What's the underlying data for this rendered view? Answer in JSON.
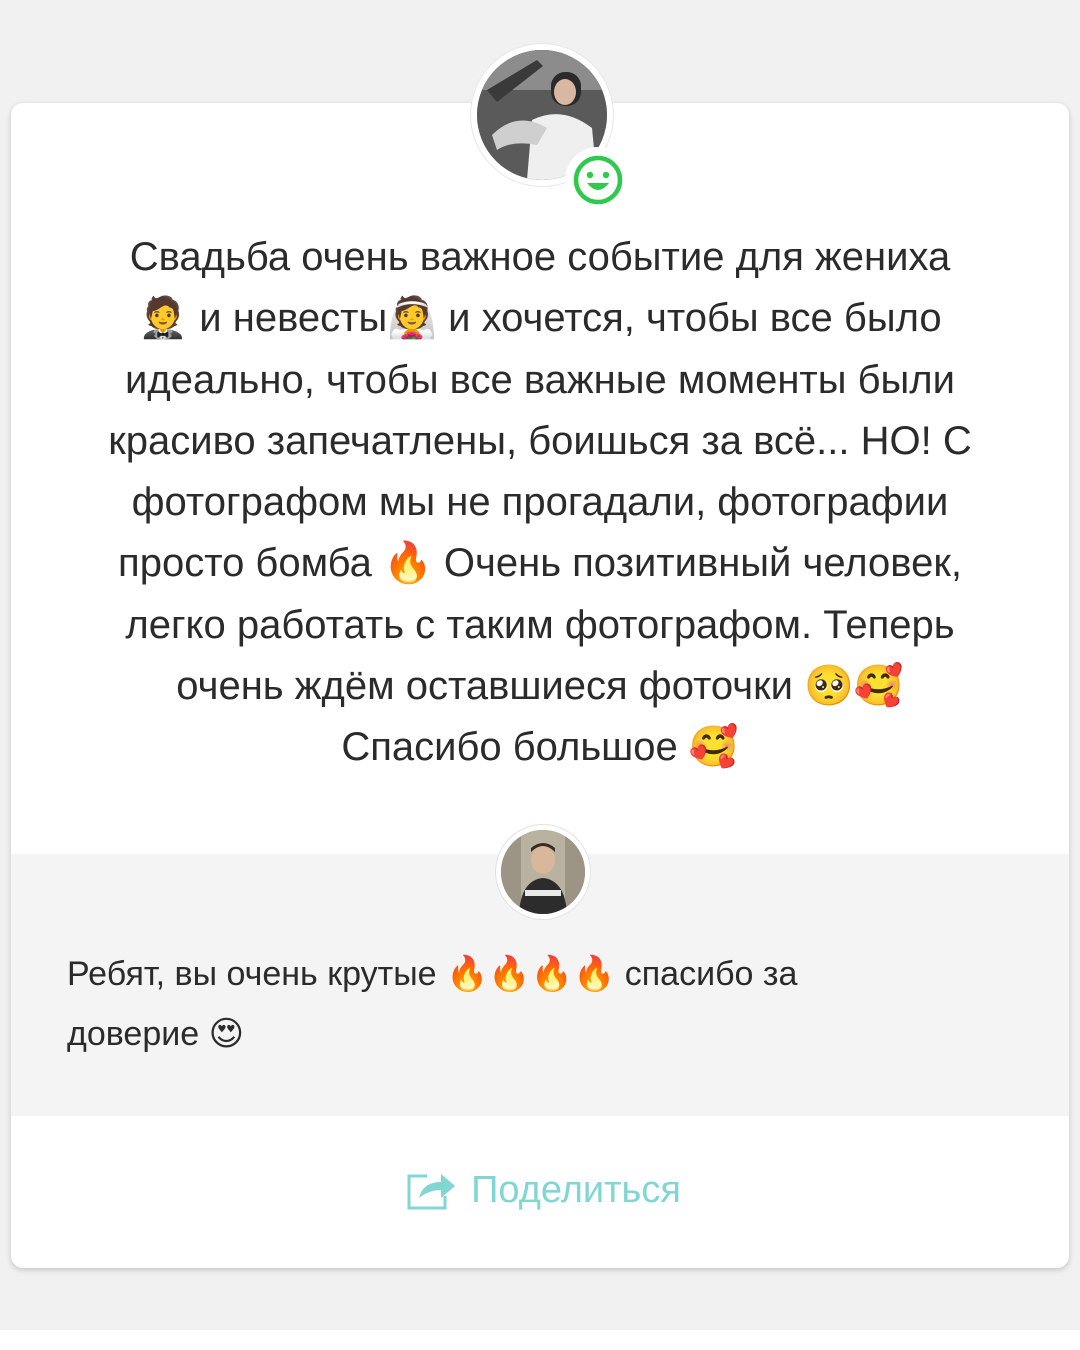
{
  "review": {
    "text": "Свадьба очень важное событие для жениха\n🤵 и невесты👰 и хочется, чтобы все было\nидеально, чтобы все важные моменты были\nкрасиво запечатлены, боишься за всё... НО! С\nфотографом мы не прогадали, фотографии\nпросто бомба 🔥 Очень позитивный человек,\nлегко работать с таким фотографом. Теперь\nочень ждём оставшиеся фоточки 🥺🥰\nСпасибо большое 🥰",
    "rating_icon": "smile-icon"
  },
  "reply": {
    "text": "Ребят, вы очень крутые 🔥🔥🔥🔥 спасибо за\nдоверие 😍"
  },
  "share": {
    "label": "Поделиться",
    "icon": "share-icon"
  },
  "colors": {
    "accent_teal": "#7fd6d3",
    "smile_green": "#2fc94e",
    "text": "#2b2b2b",
    "reply_bg": "#f4f4f4"
  }
}
